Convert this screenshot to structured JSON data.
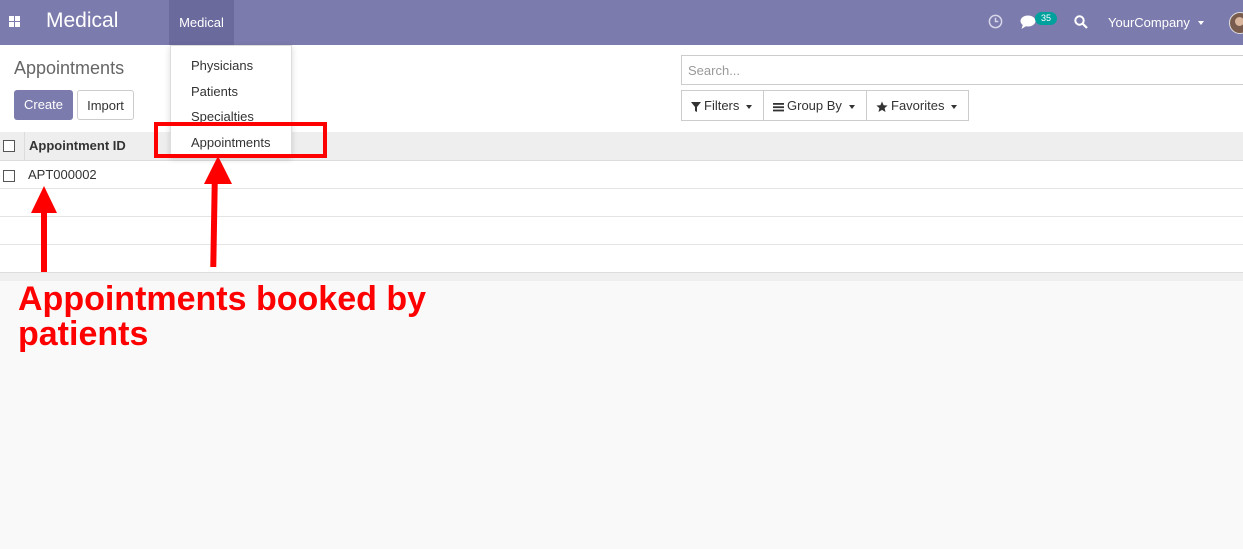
{
  "navbar": {
    "app_title": "Medical",
    "menu_label": "Medical",
    "chat_badge": "35",
    "company": "YourCompany"
  },
  "control_panel": {
    "page_title": "Appointments",
    "create_label": "Create",
    "import_label": "Import",
    "search_placeholder": "Search...",
    "filters_label": "Filters",
    "group_by_label": "Group By",
    "favorites_label": "Favorites"
  },
  "table": {
    "column_header": "Appointment ID",
    "rows": [
      "APT000002"
    ]
  },
  "dropdown": {
    "items": [
      "Physicians",
      "Patients",
      "Specialties",
      "Appointments"
    ]
  },
  "annotation": {
    "text": "Appointments booked by patients"
  },
  "colors": {
    "navbar": "#7c7bad",
    "annotation": "#ff0000",
    "badge": "#00a09d"
  }
}
